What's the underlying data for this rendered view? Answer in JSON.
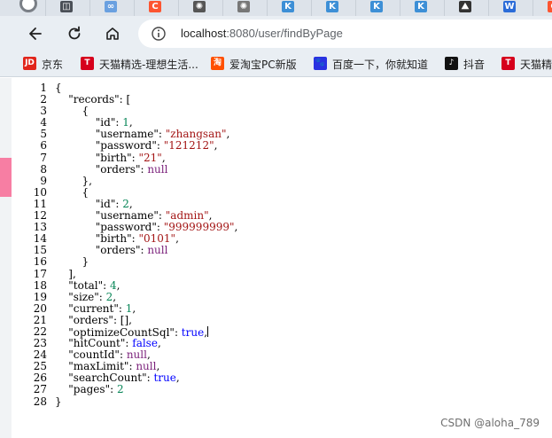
{
  "browser": {
    "tabs": [
      {
        "icon": "avatar-icon",
        "color": "#7a7f86",
        "glyph": ""
      },
      {
        "icon": "book-icon",
        "color": "#4a4f57",
        "glyph": "◫"
      },
      {
        "icon": "link-icon",
        "color": "#6aa0e0",
        "glyph": "∞"
      },
      {
        "icon": "csdn-icon",
        "color": "#fc5531",
        "glyph": "C"
      },
      {
        "icon": "chatgpt-icon",
        "color": "#555555",
        "glyph": "✺"
      },
      {
        "icon": "chatgpt-icon",
        "color": "#777777",
        "glyph": "✺"
      },
      {
        "icon": "k-icon",
        "color": "#3d8fd6",
        "glyph": "K"
      },
      {
        "icon": "k-icon",
        "color": "#3d8fd6",
        "glyph": "K"
      },
      {
        "icon": "k-icon",
        "color": "#3d8fd6",
        "glyph": "K"
      },
      {
        "icon": "k-icon",
        "color": "#3d8fd6",
        "glyph": "K"
      },
      {
        "icon": "image-icon",
        "color": "#333333",
        "glyph": "⛰"
      },
      {
        "icon": "word-icon",
        "color": "#2b6cd8",
        "glyph": "W"
      },
      {
        "icon": "csdn-icon",
        "color": "#fc5531",
        "glyph": "C"
      }
    ],
    "url_host": "localhost",
    "url_rest": ":8080/user/findByPage",
    "bookmarks": [
      {
        "label": "京东",
        "icon": "jd-icon",
        "color": "#e1251b",
        "glyph": "JD"
      },
      {
        "label": "天猫精选-理想生活...",
        "icon": "tmall-icon",
        "color": "#d6001c",
        "glyph": "T"
      },
      {
        "label": "爱淘宝PC新版",
        "icon": "taobao-icon",
        "color": "#ff5000",
        "glyph": "淘"
      },
      {
        "label": "百度一下，你就知道",
        "icon": "baidu-icon",
        "color": "#2932e1",
        "glyph": "🐾"
      },
      {
        "label": "抖音",
        "icon": "douyin-icon",
        "color": "#111111",
        "glyph": "♪"
      },
      {
        "label": "天猫精",
        "icon": "tmall-icon",
        "color": "#d6001c",
        "glyph": "T"
      }
    ]
  },
  "code_lines": [
    [
      {
        "t": "{",
        "c": "p"
      }
    ],
    [
      {
        "t": "    ",
        "c": "p"
      },
      {
        "t": "\"records\"",
        "c": "key"
      },
      {
        "t": ": [",
        "c": "p"
      }
    ],
    [
      {
        "t": "        {",
        "c": "p"
      }
    ],
    [
      {
        "t": "            ",
        "c": "p"
      },
      {
        "t": "\"id\"",
        "c": "key"
      },
      {
        "t": ": ",
        "c": "p"
      },
      {
        "t": "1",
        "c": "num"
      },
      {
        "t": ",",
        "c": "p"
      }
    ],
    [
      {
        "t": "            ",
        "c": "p"
      },
      {
        "t": "\"username\"",
        "c": "key"
      },
      {
        "t": ": ",
        "c": "p"
      },
      {
        "t": "\"zhangsan\"",
        "c": "str"
      },
      {
        "t": ",",
        "c": "p"
      }
    ],
    [
      {
        "t": "            ",
        "c": "p"
      },
      {
        "t": "\"password\"",
        "c": "key"
      },
      {
        "t": ": ",
        "c": "p"
      },
      {
        "t": "\"121212\"",
        "c": "str"
      },
      {
        "t": ",",
        "c": "p"
      }
    ],
    [
      {
        "t": "            ",
        "c": "p"
      },
      {
        "t": "\"birth\"",
        "c": "key"
      },
      {
        "t": ": ",
        "c": "p"
      },
      {
        "t": "\"21\"",
        "c": "str"
      },
      {
        "t": ",",
        "c": "p"
      }
    ],
    [
      {
        "t": "            ",
        "c": "p"
      },
      {
        "t": "\"orders\"",
        "c": "key"
      },
      {
        "t": ": ",
        "c": "p"
      },
      {
        "t": "null",
        "c": "null"
      }
    ],
    [
      {
        "t": "        },",
        "c": "p"
      }
    ],
    [
      {
        "t": "        {",
        "c": "p"
      }
    ],
    [
      {
        "t": "            ",
        "c": "p"
      },
      {
        "t": "\"id\"",
        "c": "key"
      },
      {
        "t": ": ",
        "c": "p"
      },
      {
        "t": "2",
        "c": "num"
      },
      {
        "t": ",",
        "c": "p"
      }
    ],
    [
      {
        "t": "            ",
        "c": "p"
      },
      {
        "t": "\"username\"",
        "c": "key"
      },
      {
        "t": ": ",
        "c": "p"
      },
      {
        "t": "\"admin\"",
        "c": "str"
      },
      {
        "t": ",",
        "c": "p"
      }
    ],
    [
      {
        "t": "            ",
        "c": "p"
      },
      {
        "t": "\"password\"",
        "c": "key"
      },
      {
        "t": ": ",
        "c": "p"
      },
      {
        "t": "\"999999999\"",
        "c": "str"
      },
      {
        "t": ",",
        "c": "p"
      }
    ],
    [
      {
        "t": "            ",
        "c": "p"
      },
      {
        "t": "\"birth\"",
        "c": "key"
      },
      {
        "t": ": ",
        "c": "p"
      },
      {
        "t": "\"0101\"",
        "c": "str"
      },
      {
        "t": ",",
        "c": "p"
      }
    ],
    [
      {
        "t": "            ",
        "c": "p"
      },
      {
        "t": "\"orders\"",
        "c": "key"
      },
      {
        "t": ": ",
        "c": "p"
      },
      {
        "t": "null",
        "c": "null"
      }
    ],
    [
      {
        "t": "        }",
        "c": "p"
      }
    ],
    [
      {
        "t": "    ],",
        "c": "p"
      }
    ],
    [
      {
        "t": "    ",
        "c": "p"
      },
      {
        "t": "\"total\"",
        "c": "key"
      },
      {
        "t": ": ",
        "c": "p"
      },
      {
        "t": "4",
        "c": "num"
      },
      {
        "t": ",",
        "c": "p"
      }
    ],
    [
      {
        "t": "    ",
        "c": "p"
      },
      {
        "t": "\"size\"",
        "c": "key"
      },
      {
        "t": ": ",
        "c": "p"
      },
      {
        "t": "2",
        "c": "num"
      },
      {
        "t": ",",
        "c": "p"
      }
    ],
    [
      {
        "t": "    ",
        "c": "p"
      },
      {
        "t": "\"current\"",
        "c": "key"
      },
      {
        "t": ": ",
        "c": "p"
      },
      {
        "t": "1",
        "c": "num"
      },
      {
        "t": ",",
        "c": "p"
      }
    ],
    [
      {
        "t": "    ",
        "c": "p"
      },
      {
        "t": "\"orders\"",
        "c": "key"
      },
      {
        "t": ": [],",
        "c": "p"
      }
    ],
    [
      {
        "t": "    ",
        "c": "p"
      },
      {
        "t": "\"optimizeCountSql\"",
        "c": "key"
      },
      {
        "t": ": ",
        "c": "p"
      },
      {
        "t": "true",
        "c": "lit"
      },
      {
        "t": ",",
        "c": "p"
      },
      {
        "t": "",
        "c": "caret"
      }
    ],
    [
      {
        "t": "    ",
        "c": "p"
      },
      {
        "t": "\"hitCount\"",
        "c": "key"
      },
      {
        "t": ": ",
        "c": "p"
      },
      {
        "t": "false",
        "c": "lit"
      },
      {
        "t": ",",
        "c": "p"
      }
    ],
    [
      {
        "t": "    ",
        "c": "p"
      },
      {
        "t": "\"countId\"",
        "c": "key"
      },
      {
        "t": ": ",
        "c": "p"
      },
      {
        "t": "null",
        "c": "null"
      },
      {
        "t": ",",
        "c": "p"
      }
    ],
    [
      {
        "t": "    ",
        "c": "p"
      },
      {
        "t": "\"maxLimit\"",
        "c": "key"
      },
      {
        "t": ": ",
        "c": "p"
      },
      {
        "t": "null",
        "c": "null"
      },
      {
        "t": ",",
        "c": "p"
      }
    ],
    [
      {
        "t": "    ",
        "c": "p"
      },
      {
        "t": "\"searchCount\"",
        "c": "key"
      },
      {
        "t": ": ",
        "c": "p"
      },
      {
        "t": "true",
        "c": "lit"
      },
      {
        "t": ",",
        "c": "p"
      }
    ],
    [
      {
        "t": "    ",
        "c": "p"
      },
      {
        "t": "\"pages\"",
        "c": "key"
      },
      {
        "t": ": ",
        "c": "p"
      },
      {
        "t": "2",
        "c": "num"
      }
    ],
    [
      {
        "t": "}",
        "c": "p"
      }
    ]
  ],
  "watermark": "CSDN @aloha_789",
  "colors": {
    "string": "#a31515",
    "number": "#098658",
    "literal": "#0000ff",
    "null": "#7a1f7a",
    "accent_pink": "#f77ea3"
  }
}
